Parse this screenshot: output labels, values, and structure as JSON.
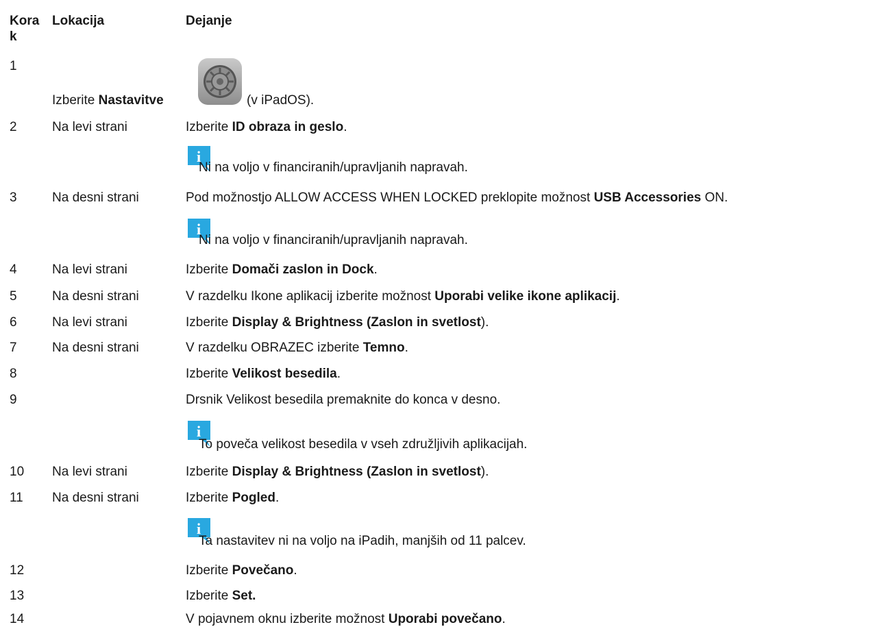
{
  "header": {
    "step": "Kora\nk",
    "step_line1": "Kora",
    "step_line2": "k",
    "location": "Lokacija",
    "action": "Dejanje"
  },
  "rows": [
    {
      "step": "1",
      "location": "",
      "pre": "Izberite ",
      "bold": "Nastavitve",
      "post": "(v iPadOS).",
      "icon": "settings-gear-icon"
    },
    {
      "step": "2",
      "location": "Na levi strani",
      "pre": "Izberite ",
      "bold": "ID obraza in geslo",
      "post": "."
    },
    {
      "step": "",
      "location": "",
      "note": "Ni na voljo v financiranih/upravljanih napravah."
    },
    {
      "step": "3",
      "location": "Na desni strani",
      "pre": "Pod možnostjo ALLOW ACCESS WHEN LOCKED preklopite možnost ",
      "bold": "USB Accessories",
      "post": " ON."
    },
    {
      "step": "",
      "location": "",
      "note": "Ni na voljo v financiranih/upravljanih napravah."
    },
    {
      "step": "4",
      "location": "Na levi strani",
      "pre": "Izberite ",
      "bold": "Domači zaslon in Dock",
      "post": "."
    },
    {
      "step": "5",
      "location": "Na desni strani",
      "pre": "V razdelku Ikone aplikacij izberite možnost ",
      "bold": "Uporabi velike ikone aplikacij",
      "post": "."
    },
    {
      "step": "6",
      "location": "Na levi strani",
      "pre": "Izberite ",
      "bold": "Display & Brightness (Zaslon in svetlost",
      "post": ")."
    },
    {
      "step": "7",
      "location": "Na desni strani",
      "pre": "V razdelku OBRAZEC izberite ",
      "bold": "Temno",
      "post": "."
    },
    {
      "step": "8",
      "location": "",
      "pre": "Izberite ",
      "bold": "Velikost besedila",
      "post": "."
    },
    {
      "step": "9",
      "location": "",
      "pre": "Drsnik Velikost besedila premaknite do konca v desno.",
      "bold": "",
      "post": ""
    },
    {
      "step": "",
      "location": "",
      "note": "To poveča velikost besedila v vseh združljivih aplikacijah."
    },
    {
      "step": "10",
      "location": "Na levi strani",
      "pre": "Izberite ",
      "bold": "Display & Brightness (Zaslon in svetlost",
      "post": ")."
    },
    {
      "step": "11",
      "location": "Na desni strani",
      "pre": "Izberite ",
      "bold": "Pogled",
      "post": "."
    },
    {
      "step": "",
      "location": "",
      "note": "Ta nastavitev ni na voljo na iPadih, manjših od 11 palcev."
    },
    {
      "step": "12",
      "location": "",
      "pre": "Izberite ",
      "bold": "Povečano",
      "post": "."
    },
    {
      "step": "13",
      "location": "",
      "pre": "Izberite ",
      "bold": "Set.",
      "post": ""
    },
    {
      "step": "14",
      "location": "",
      "pre": "V pojavnem oknu izberite možnost ",
      "bold": "Uporabi povečano",
      "post": "."
    }
  ],
  "info_icon": {
    "glyph": "i",
    "color": "#29a8e0"
  }
}
